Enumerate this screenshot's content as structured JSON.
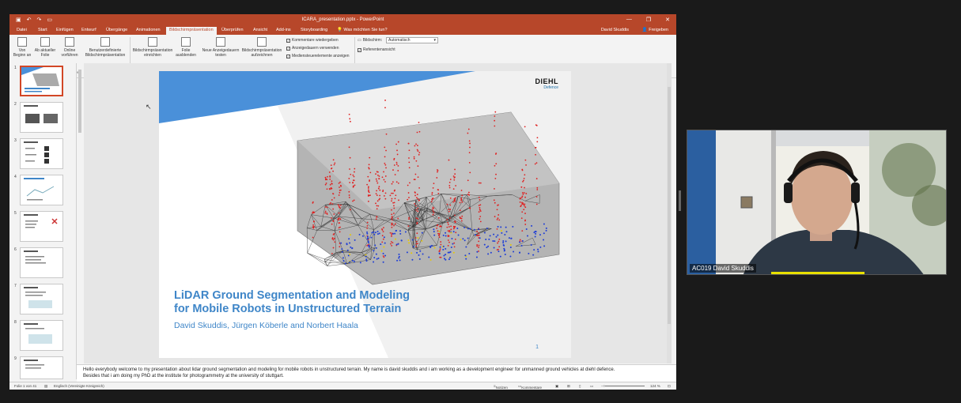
{
  "window": {
    "title": "ICARA_presentation.pptx  -  PowerPoint",
    "controls": [
      "—",
      "❐",
      "✕"
    ]
  },
  "tabs": [
    "Datei",
    "Start",
    "Einfügen",
    "Entwurf",
    "Übergänge",
    "Animationen",
    "Bildschirmpräsentation",
    "Überprüfen",
    "Ansicht",
    "Add-ins",
    "Storyboarding",
    "Was möchten Sie tun?"
  ],
  "active_tab": "Bildschirmpräsentation",
  "user": "David Skuddis",
  "share": "Freigeben",
  "ribbon": {
    "buttons": {
      "from_start": "Von Beginn an",
      "from_current": "Ab aktueller Folie",
      "online": "Online vorführen",
      "custom": "Benutzerdefinierte Bildschirmpräsentation",
      "setup": "Bildschirmpräsentation einrichten",
      "hide": "Folie ausblenden",
      "rehearse": "Neue Anzeigedauern testen",
      "record": "Bildschirmpräsentation aufzeichnen"
    },
    "checks": {
      "comments": "Kommentare wiedergeben",
      "timings": "Anzeigedauern verwenden",
      "media": "Mediensteuerelemente anzeigen",
      "monitor": "Bildschirm:",
      "monitor_value": "Automatisch",
      "presenter": "Referentenansicht"
    },
    "groups": {
      "start": "Bildschirmpräsentation starten",
      "setup": "Einrichten",
      "monitors": "Bildschirme"
    }
  },
  "thumbnails": [
    1,
    2,
    3,
    4,
    5,
    6,
    7,
    8,
    9
  ],
  "slide": {
    "logo_main": "DIEHL",
    "logo_sub": "Defence",
    "title_line1": "LiDAR Ground Segmentation and Modeling",
    "title_line2": "for Mobile Robots in Unstructured Terrain",
    "authors": "David Skuddis, Jürgen Köberle and Norbert Haala",
    "number": "1",
    "colors": {
      "title": "#3f86c8",
      "stripe": "#4a90d9",
      "accent": "#b7472a"
    }
  },
  "notes": {
    "line1": "Hello everybody welcome to my presentation about lidar ground segmentation and modeling for mobile robots in unstructured terrain. My name is david skuddis and i am working as a development engineer for unmanned ground vehicles at diehl defence.",
    "line2": "Besides that i am doing my PhD at the institute for photogrammetry at the university of stuttgart."
  },
  "status": {
    "slide_info": "Folie 1 von 41",
    "language": "Englisch (Vereinigte Königreich)",
    "notes_btn": "Notizen",
    "comments_btn": "Kommentare",
    "zoom": "124 %"
  },
  "video": {
    "name": "AC019 David Skuddis"
  }
}
